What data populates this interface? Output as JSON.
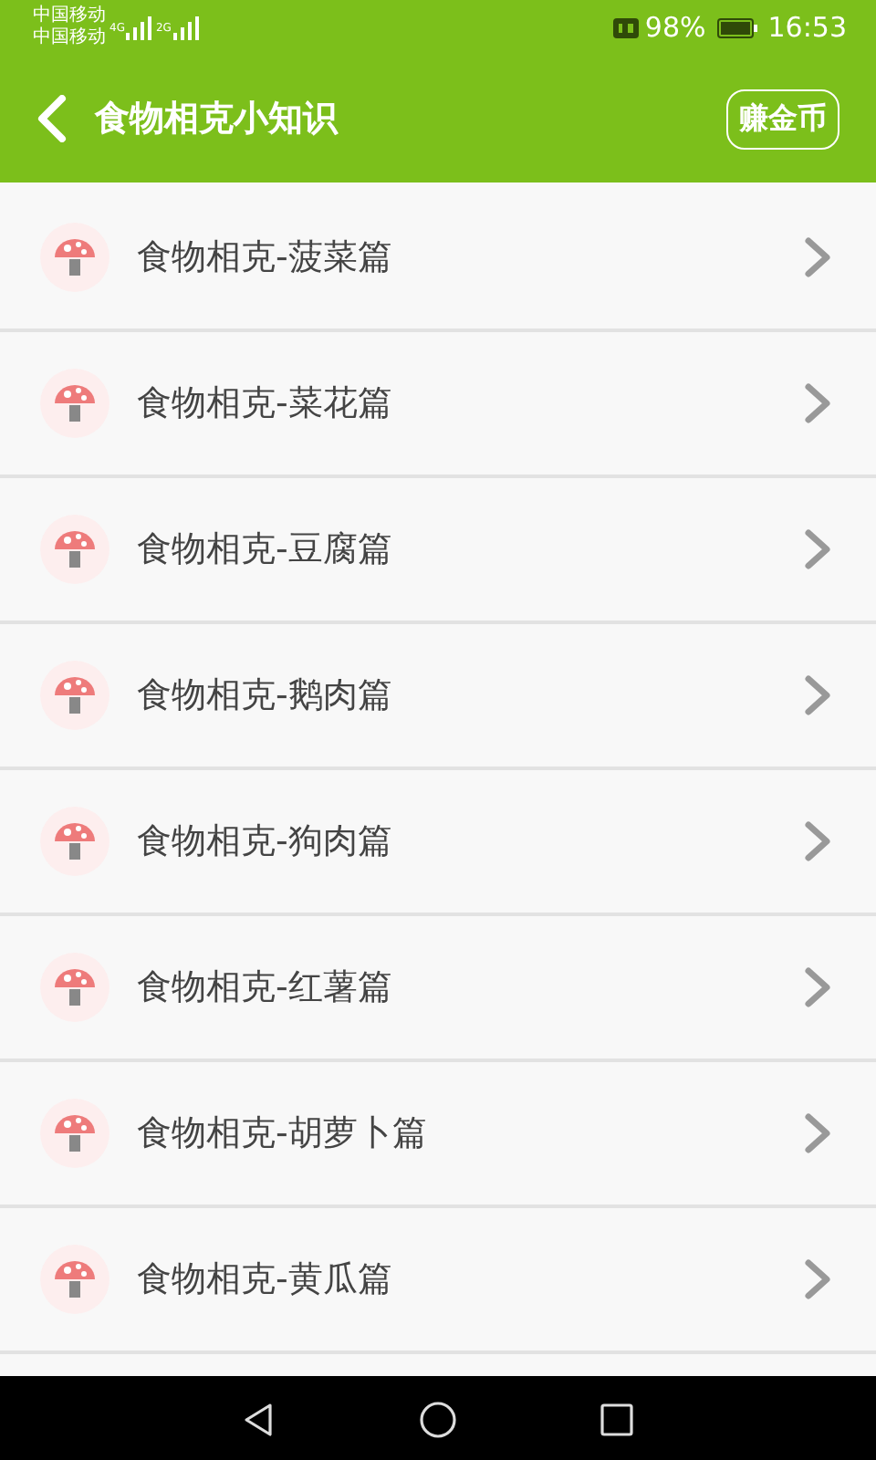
{
  "status_bar": {
    "carriers": [
      "中国移动",
      "中国移动"
    ],
    "network_1": "4G",
    "network_2": "2G",
    "battery": "98%",
    "time": "16:53"
  },
  "header": {
    "title": "食物相克小知识",
    "action": "赚金币"
  },
  "items": [
    {
      "label": "食物相克-菠菜篇"
    },
    {
      "label": "食物相克-菜花篇"
    },
    {
      "label": "食物相克-豆腐篇"
    },
    {
      "label": "食物相克-鹅肉篇"
    },
    {
      "label": "食物相克-狗肉篇"
    },
    {
      "label": "食物相克-红薯篇"
    },
    {
      "label": "食物相克-胡萝卜篇"
    },
    {
      "label": "食物相克-黄瓜篇"
    }
  ]
}
